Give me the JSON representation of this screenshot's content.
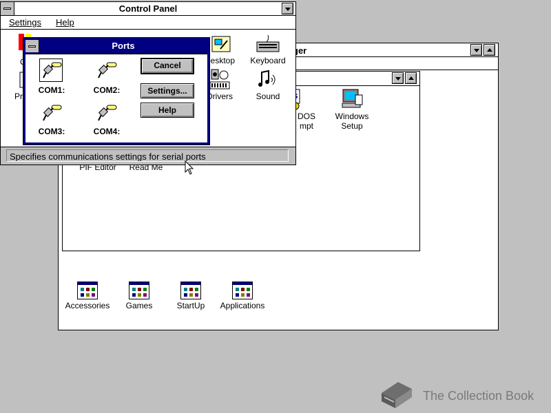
{
  "program_manager": {
    "title_partial": "ger",
    "program_groups": [
      {
        "label": "Accessories"
      },
      {
        "label": "Games"
      },
      {
        "label": "StartUp"
      },
      {
        "label": "Applications"
      }
    ],
    "main_group": {
      "visible_icons": [
        {
          "label_line1": "Windows",
          "label_line2": "Setup"
        },
        {
          "label_line1": "DOS",
          "label_line2": "mpt"
        }
      ],
      "partial_labels": [
        "PIF Editor",
        "Read Me"
      ]
    }
  },
  "control_panel": {
    "title": "Control Panel",
    "menu": [
      {
        "label": "Settings",
        "accel": "S"
      },
      {
        "label": "Help",
        "accel": "H"
      }
    ],
    "icons": [
      {
        "label": "Desktop"
      },
      {
        "label": "Keyboard"
      },
      {
        "label": "Drivers"
      },
      {
        "label": "Sound"
      },
      {
        "label": "Pr"
      },
      {
        "label": "C"
      }
    ],
    "status_text": "Specifies communications settings for serial ports"
  },
  "ports_dialog": {
    "title": "Ports",
    "ports": [
      {
        "label": "COM1:",
        "selected": true
      },
      {
        "label": "COM2:",
        "selected": false
      },
      {
        "label": "COM3:",
        "selected": false
      },
      {
        "label": "COM4:",
        "selected": false
      }
    ],
    "buttons": {
      "cancel": "Cancel",
      "settings": "Settings...",
      "help": "Help"
    }
  },
  "watermark": {
    "text": "The Collection Book"
  },
  "colors": {
    "desktop": "#c0c0c0",
    "active_title": "#000080",
    "window_bg": "#ffffff"
  }
}
